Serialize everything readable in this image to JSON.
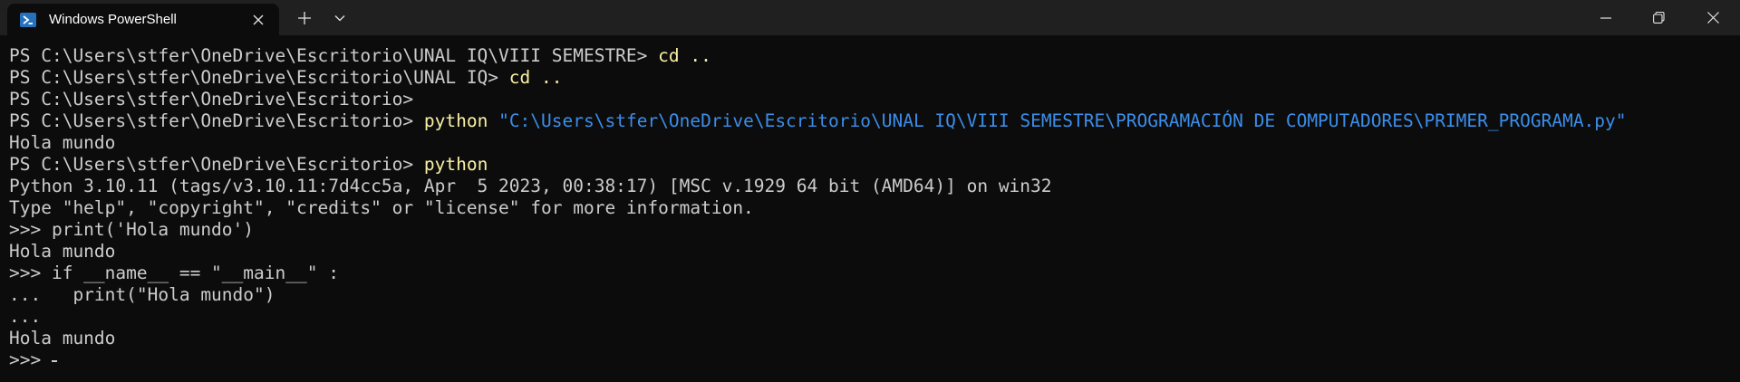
{
  "titlebar": {
    "tab_title": "Windows PowerShell",
    "tab_icon": "powershell-icon",
    "new_tab_icon": "plus-icon",
    "dropdown_icon": "chevron-down-icon",
    "minimize_icon": "minimize-icon",
    "maximize_icon": "restore-icon",
    "close_icon": "close-icon",
    "tab_close_icon": "close-icon"
  },
  "colors": {
    "background": "#0c0c0c",
    "titlebar": "#202020",
    "text": "#cccccc",
    "command": "#f9f1a5",
    "string": "#3b8eea"
  },
  "terminal": {
    "lines": [
      {
        "prompt": "PS C:\\Users\\stfer\\OneDrive\\Escritorio\\UNAL IQ\\VIII SEMESTRE> ",
        "command": "cd",
        "args": " ..",
        "string": ""
      },
      {
        "prompt": "PS C:\\Users\\stfer\\OneDrive\\Escritorio\\UNAL IQ> ",
        "command": "cd",
        "args": " ..",
        "string": ""
      },
      {
        "prompt": "PS C:\\Users\\stfer\\OneDrive\\Escritorio> ",
        "command": "",
        "args": "",
        "string": ""
      },
      {
        "prompt": "PS C:\\Users\\stfer\\OneDrive\\Escritorio> ",
        "command": "python",
        "args": " ",
        "string": "\"C:\\Users\\stfer\\OneDrive\\Escritorio\\UNAL IQ\\VIII SEMESTRE\\PROGRAMACIÓN DE COMPUTADORES\\PRIMER_PROGRAMA.py\""
      },
      {
        "prompt": "Hola mundo",
        "command": "",
        "args": "",
        "string": ""
      },
      {
        "prompt": "PS C:\\Users\\stfer\\OneDrive\\Escritorio> ",
        "command": "python",
        "args": "",
        "string": ""
      },
      {
        "prompt": "Python 3.10.11 (tags/v3.10.11:7d4cc5a, Apr  5 2023, 00:38:17) [MSC v.1929 64 bit (AMD64)] on win32",
        "command": "",
        "args": "",
        "string": ""
      },
      {
        "prompt": "Type \"help\", \"copyright\", \"credits\" or \"license\" for more information.",
        "command": "",
        "args": "",
        "string": ""
      },
      {
        "prompt": ">>> print('Hola mundo')",
        "command": "",
        "args": "",
        "string": ""
      },
      {
        "prompt": "Hola mundo",
        "command": "",
        "args": "",
        "string": ""
      },
      {
        "prompt": ">>> if __name__ == \"__main__\" :",
        "command": "",
        "args": "",
        "string": ""
      },
      {
        "prompt": "...   print(\"Hola mundo\")",
        "command": "",
        "args": "",
        "string": ""
      },
      {
        "prompt": "...",
        "command": "",
        "args": "",
        "string": ""
      },
      {
        "prompt": "Hola mundo",
        "command": "",
        "args": "",
        "string": ""
      },
      {
        "prompt": ">>> ",
        "command": "",
        "args": "",
        "string": ""
      }
    ]
  }
}
